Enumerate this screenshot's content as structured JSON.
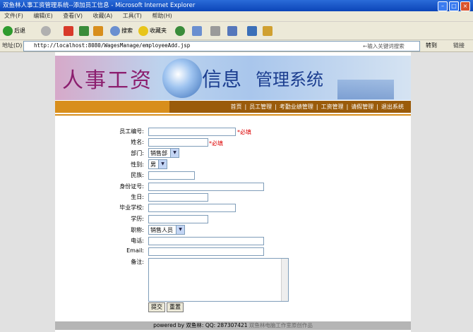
{
  "window": {
    "title": "双鱼林人事工资管理系统--添加员工信息 - Microsoft Internet Explorer"
  },
  "menu": [
    "文件(F)",
    "编辑(E)",
    "查看(V)",
    "收藏(A)",
    "工具(T)",
    "帮助(H)"
  ],
  "toolbar": {
    "back": "后退",
    "search": "搜索",
    "favorites": "收藏夹"
  },
  "address": {
    "label": "地址(D)",
    "url": "http://localhost:8080/WagesManage/employeeAdd.jsp",
    "search_hint": "←输入关键词搜索",
    "go": "转到",
    "links": "链接"
  },
  "banner": {
    "t1": "人事工资",
    "t2": "信息",
    "t3": "管理系统"
  },
  "nav": [
    "首页",
    "员工管理",
    "考勤业绩管理",
    "工资管理",
    "请假管理",
    "退出系统"
  ],
  "form": {
    "labels": {
      "emp_no": "员工编号:",
      "name": "姓名:",
      "dept": "部门:",
      "gender": "性别:",
      "ethnic": "民族:",
      "id_card": "身份证号:",
      "birthday": "生日:",
      "school": "毕业学校:",
      "edu": "学历:",
      "position": "职称:",
      "phone": "电话:",
      "email": "Email:",
      "note": "备注:"
    },
    "required": "*必填",
    "dept_value": "销售部",
    "gender_value": "男",
    "position_value": "销售人员",
    "submit": "提交",
    "reset": "重置"
  },
  "footer": {
    "powered": "powered by 双鱼林: QQ: 287307421",
    "tail": "双鱼林电脑工作室原创作品"
  }
}
